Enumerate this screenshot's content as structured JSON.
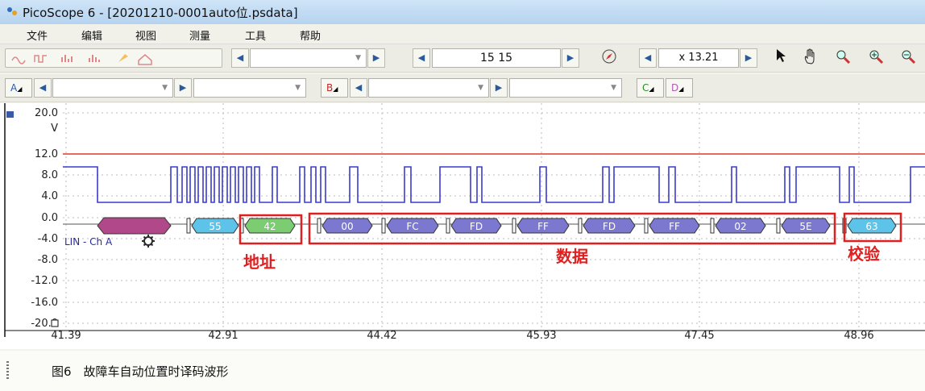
{
  "window": {
    "title": "PicoScope 6 - [20201210-0001auto位.psdata]"
  },
  "menu": [
    "文件",
    "编辑",
    "视图",
    "测量",
    "工具",
    "帮助"
  ],
  "toolbar": {
    "capture_count": "15 15",
    "zoom": "x 13.21"
  },
  "channels": {
    "a": "A",
    "b": "B",
    "c": "C",
    "d": "D"
  },
  "plot": {
    "y_axis_labels": [
      "20.0",
      "V",
      "12.0",
      "8.0",
      "4.0",
      "0.0",
      "-4.0",
      "-8.0",
      "-12.0",
      "-16.0",
      "-20.0"
    ],
    "x_axis_labels": [
      "41.39",
      "42.91",
      "44.42",
      "45.93",
      "47.45",
      "48.96"
    ],
    "decoder_label": "LIN - Ch A",
    "decoded_bytes": [
      "55",
      "42",
      "00",
      "FC",
      "FD",
      "FF",
      "FD",
      "FF",
      "02",
      "5E",
      "63"
    ],
    "annotations": {
      "address": "地址",
      "data": "数据",
      "checksum": "校验"
    },
    "colors": {
      "trace": "#3a3ad0",
      "threshold": "#e03a2a",
      "annotation": "#e02020",
      "sync_byte": "#5ec3e8",
      "id_byte": "#7ccc72",
      "data_byte": "#7c78d0",
      "break_field": "#b0488a"
    }
  },
  "caption": "图6　故障车自动位置时译码波形"
}
